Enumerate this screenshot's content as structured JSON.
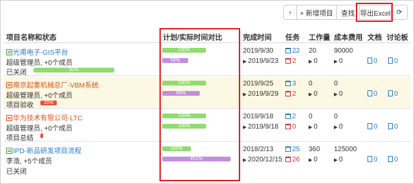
{
  "toolbar": {
    "back_icon": "chevron-left-icon",
    "new_label": "+ 新增项目",
    "find_label": "查找",
    "export_label": "导出Excel",
    "refresh_icon": "refresh-icon"
  },
  "headers": {
    "name": "项目名称和状态",
    "plan_vs_actual": "计划/实际时间对比",
    "done_time": "完成时间",
    "tasks": "任务",
    "workload": "工作量",
    "cost": "成本费用",
    "docs": "文档",
    "discussion": "讨论板"
  },
  "rows": [
    {
      "name": "光甫电子-GIS平台",
      "members": "超级管理员, +0个成员",
      "status_label": "已关闭",
      "status_value": "92%",
      "plan_bar": "100%",
      "actual_bar": "58%",
      "plan_date": "2019/9/30",
      "actual_date": "2019/9/23",
      "tasks_total": "22",
      "tasks_open": "2",
      "workload": "20",
      "workload2": "0",
      "cost": "90000",
      "cost2": "0",
      "docs": "0",
      "discussion": "0"
    },
    {
      "name": "南京起重机械总厂-VBM系统",
      "members": "超级管理员, +0个成员",
      "status_label": "项目验收",
      "status_value": "20%",
      "plan_bar": "100%",
      "actual_bar": "86%",
      "plan_date": "2019/9/25",
      "actual_date": "2019/9/29",
      "tasks_total": "3",
      "tasks_open": "2",
      "workload": "0",
      "workload2": "0",
      "cost": "0",
      "cost2": "0",
      "docs": "0",
      "discussion": "0"
    },
    {
      "name": "华为技术有限公司-LTC",
      "members": "超级管理员, +0个成员",
      "status_label": "项目总结",
      "status_value": "",
      "plan_bar": "100%",
      "actual_bar": "100%",
      "plan_date": "2019/9/18",
      "actual_date": "2019/9/18",
      "tasks_total": "2",
      "tasks_open": "0",
      "workload": "0",
      "workload2": "0",
      "cost": "0",
      "cost2": "0",
      "docs": "0",
      "discussion": "0"
    },
    {
      "name": "IPD-新品研发项目流程",
      "members": "李浩, +5个成员",
      "status_label": "已关闭",
      "status_value": "",
      "plan_bar": "100%",
      "actual_bar": "451%",
      "plan_date": "2018/2/13",
      "actual_date": "2020/12/15",
      "tasks_total": "25",
      "tasks_open": "26",
      "workload": "360",
      "workload2": "0",
      "cost": "125000",
      "cost2": "0",
      "docs": "0",
      "discussion": "0"
    }
  ],
  "colors": {
    "highlight_red": "#e02020",
    "bar_green": "#8fdc70",
    "bar_purple": "#c38ee0",
    "link_blue": "#2a7cc7",
    "row_highlight": "#fcf8e3"
  }
}
